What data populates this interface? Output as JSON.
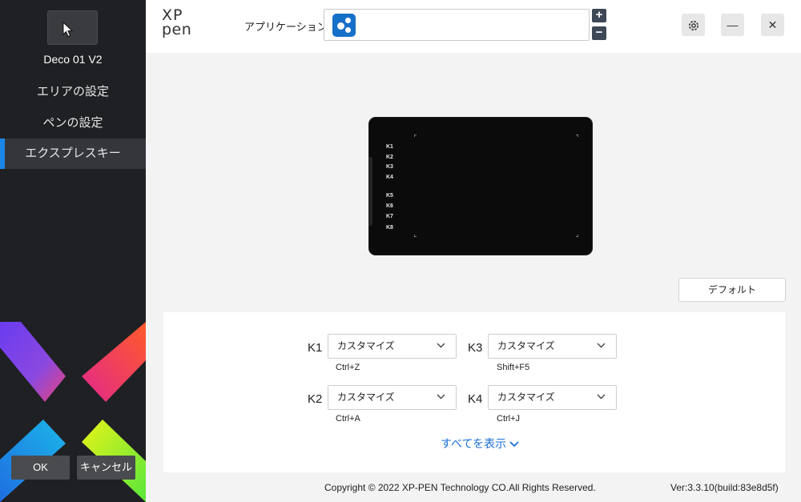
{
  "sidebar": {
    "device_name": "Deco 01 V2",
    "nav": [
      {
        "label": "エリアの設定"
      },
      {
        "label": "ペンの設定"
      },
      {
        "label": "エクスプレスキー"
      }
    ],
    "ok_label": "OK",
    "cancel_label": "キャンセル"
  },
  "header": {
    "brand_top": "XP",
    "brand_bottom": "pen",
    "app_label": "アプリケーション:",
    "plus": "+",
    "minus": "−",
    "minimize": "—",
    "close": "✕"
  },
  "tablet": {
    "keys": [
      "K1",
      "K2",
      "K3",
      "K4",
      "K5",
      "K6",
      "K7",
      "K8"
    ]
  },
  "default_label": "デフォルト",
  "express_keys": [
    {
      "key": "K1",
      "action": "カスタマイズ",
      "shortcut": "Ctrl+Z"
    },
    {
      "key": "K3",
      "action": "カスタマイズ",
      "shortcut": "Shift+F5"
    },
    {
      "key": "K2",
      "action": "カスタマイズ",
      "shortcut": "Ctrl+A"
    },
    {
      "key": "K4",
      "action": "カスタマイズ",
      "shortcut": "Ctrl+J"
    }
  ],
  "show_all": "すべてを表示",
  "footer": {
    "copyright": "Copyright © 2022  XP-PEN Technology CO.All Rights Reserved.",
    "version": "Ver:3.3.10(build:83e8d5f)"
  },
  "colors": {
    "accent": "#1a86e8",
    "sidebar_bg": "#1f2024",
    "link": "#1a6fd8"
  }
}
